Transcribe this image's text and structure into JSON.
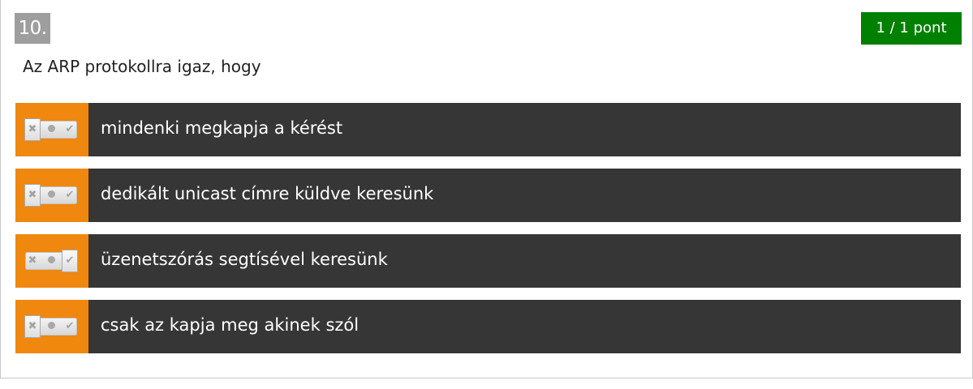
{
  "question": {
    "number": "10.",
    "points": "1 / 1 pont",
    "text": "Az ARP protokollra igaz, hogy"
  },
  "answers": [
    {
      "text": "mindenki megkapja a kérést",
      "toggle_state": "false"
    },
    {
      "text": "dedikált unicast címre küldve keresünk",
      "toggle_state": "false"
    },
    {
      "text": "üzenetszórás segtísével keresünk",
      "toggle_state": "true"
    },
    {
      "text": "csak az kapja meg akinek szól",
      "toggle_state": "false"
    }
  ],
  "icons": {
    "false_symbol": "x-icon",
    "neutral_symbol": "dot-icon",
    "true_symbol": "check-icon"
  },
  "colors": {
    "number_badge": "#9e9e9e",
    "points_badge": "#008000",
    "toggle_cell": "#f0870e",
    "answer_bar": "#363636"
  }
}
